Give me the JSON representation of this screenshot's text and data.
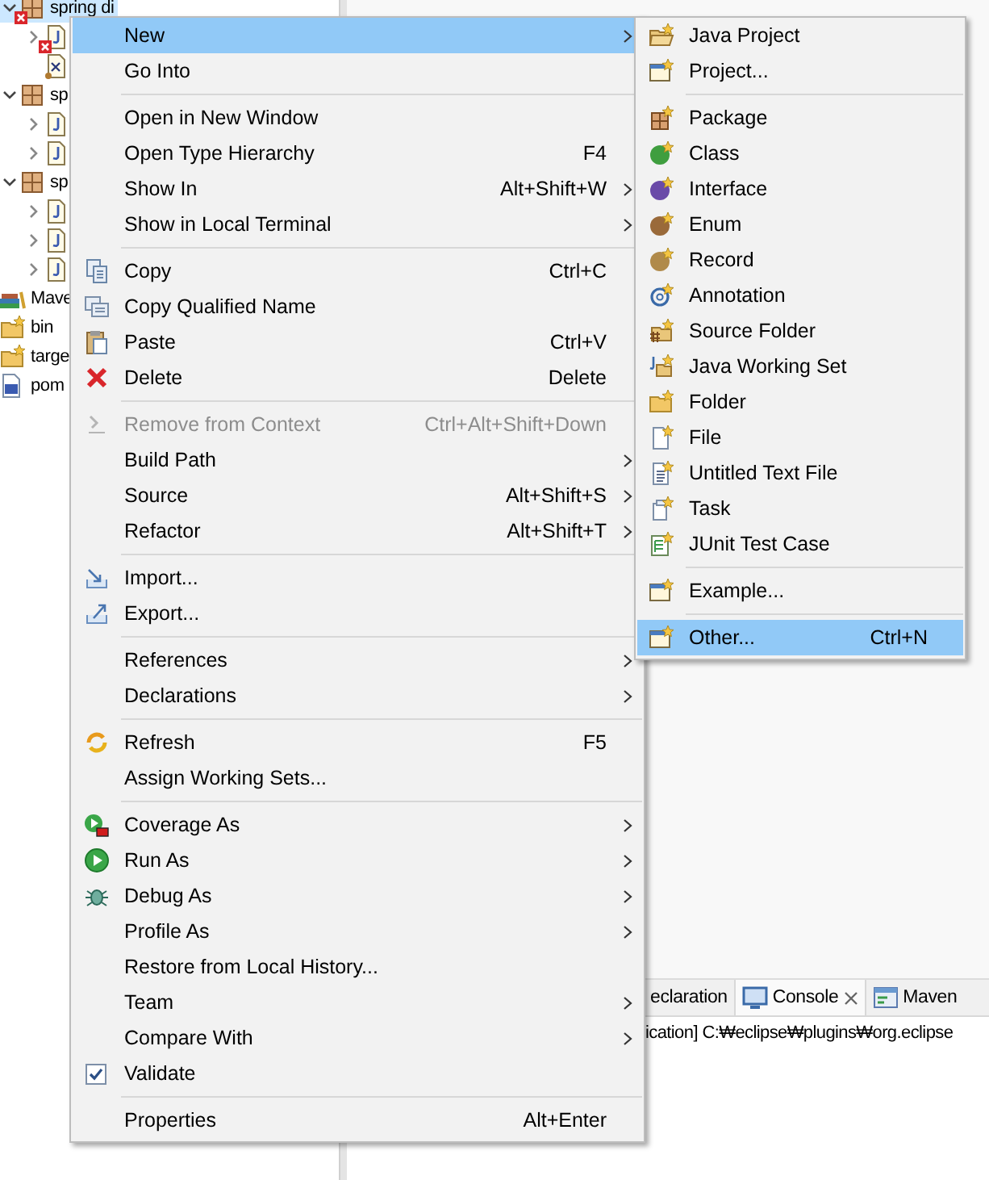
{
  "tree": [
    {
      "label": "spring di",
      "kind": "project",
      "error": true,
      "selected": true,
      "expanded": true,
      "children": [
        {
          "kind": "javafile",
          "error": true,
          "selected": false,
          "expanded": false
        },
        {
          "kind": "xmlfile",
          "error": false,
          "selected": false
        }
      ]
    },
    {
      "label": "sp",
      "kind": "project",
      "error": false,
      "selected": false,
      "expanded": true,
      "children": [
        {
          "kind": "javafile",
          "error": false,
          "selected": false,
          "expanded": false
        },
        {
          "kind": "javafile",
          "error": false,
          "selected": false,
          "expanded": false
        }
      ]
    },
    {
      "label": "sp",
      "kind": "project",
      "error": false,
      "selected": false,
      "expanded": true,
      "children": [
        {
          "kind": "javafile",
          "error": false,
          "selected": false,
          "expanded": false
        },
        {
          "kind": "javafile",
          "error": false,
          "selected": false,
          "expanded": false
        },
        {
          "kind": "javafile",
          "error": false,
          "selected": false,
          "expanded": false
        }
      ]
    }
  ],
  "tree_extra": [
    {
      "label": "Mave",
      "kind": "library"
    },
    {
      "label": "bin",
      "kind": "folder"
    },
    {
      "label": "targe",
      "kind": "folder"
    },
    {
      "label": "pom",
      "kind": "pom"
    }
  ],
  "context_menu": [
    {
      "kind": "plain",
      "label": "New",
      "submenu": true,
      "selected": true
    },
    {
      "kind": "plain",
      "label": "Go Into",
      "selected": false
    },
    {
      "kind": "separator"
    },
    {
      "kind": "plain",
      "label": "Open in New Window",
      "selected": false
    },
    {
      "kind": "plain",
      "label": "Open Type Hierarchy",
      "shortcut": "F4",
      "selected": false
    },
    {
      "kind": "plain",
      "label": "Show In",
      "shortcut": "Alt+Shift+W",
      "submenu": true,
      "selected": false
    },
    {
      "kind": "plain",
      "label": "Show in Local Terminal",
      "submenu": true,
      "selected": false
    },
    {
      "kind": "separator"
    },
    {
      "kind": "copy",
      "label": "Copy",
      "shortcut": "Ctrl+C",
      "selected": false
    },
    {
      "kind": "copyname",
      "label": "Copy Qualified Name",
      "selected": false
    },
    {
      "kind": "paste",
      "label": "Paste",
      "shortcut": "Ctrl+V",
      "selected": false
    },
    {
      "kind": "delete",
      "label": "Delete",
      "shortcut": "Delete",
      "selected": false
    },
    {
      "kind": "separator"
    },
    {
      "kind": "remove",
      "label": "Remove from Context",
      "shortcut": "Ctrl+Alt+Shift+Down",
      "disabled": true,
      "selected": false
    },
    {
      "kind": "plain",
      "label": "Build Path",
      "submenu": true,
      "selected": false
    },
    {
      "kind": "plain",
      "label": "Source",
      "shortcut": "Alt+Shift+S",
      "submenu": true,
      "selected": false
    },
    {
      "kind": "plain",
      "label": "Refactor",
      "shortcut": "Alt+Shift+T",
      "submenu": true,
      "selected": false
    },
    {
      "kind": "separator"
    },
    {
      "kind": "import",
      "label": "Import...",
      "selected": false
    },
    {
      "kind": "export",
      "label": "Export...",
      "selected": false
    },
    {
      "kind": "separator"
    },
    {
      "kind": "plain",
      "label": "References",
      "submenu": true,
      "selected": false
    },
    {
      "kind": "plain",
      "label": "Declarations",
      "submenu": true,
      "selected": false
    },
    {
      "kind": "separator"
    },
    {
      "kind": "refresh",
      "label": "Refresh",
      "shortcut": "F5",
      "selected": false
    },
    {
      "kind": "plain",
      "label": "Assign Working Sets...",
      "selected": false
    },
    {
      "kind": "separator"
    },
    {
      "kind": "coverage",
      "label": "Coverage As",
      "submenu": true,
      "selected": false
    },
    {
      "kind": "run",
      "label": "Run As",
      "submenu": true,
      "selected": false
    },
    {
      "kind": "debug",
      "label": "Debug As",
      "submenu": true,
      "selected": false
    },
    {
      "kind": "plain",
      "label": "Profile As",
      "submenu": true,
      "selected": false
    },
    {
      "kind": "plain",
      "label": "Restore from Local History...",
      "selected": false
    },
    {
      "kind": "plain",
      "label": "Team",
      "submenu": true,
      "selected": false
    },
    {
      "kind": "plain",
      "label": "Compare With",
      "submenu": true,
      "selected": false
    },
    {
      "kind": "check",
      "label": "Validate",
      "selected": false
    },
    {
      "kind": "separator"
    },
    {
      "kind": "plain",
      "label": "Properties",
      "shortcut": "Alt+Enter",
      "selected": false
    }
  ],
  "new_submenu": [
    {
      "kind": "javaproject",
      "label": "Java Project",
      "selected": false
    },
    {
      "kind": "window",
      "label": "Project...",
      "selected": false
    },
    {
      "kind": "separator"
    },
    {
      "kind": "package",
      "label": "Package",
      "selected": false
    },
    {
      "kind": "class",
      "label": "Class",
      "selected": false
    },
    {
      "kind": "interface",
      "label": "Interface",
      "selected": false
    },
    {
      "kind": "enum",
      "label": "Enum",
      "selected": false
    },
    {
      "kind": "record",
      "label": "Record",
      "selected": false
    },
    {
      "kind": "annotation",
      "label": "Annotation",
      "selected": false
    },
    {
      "kind": "sourcefolder",
      "label": "Source Folder",
      "selected": false
    },
    {
      "kind": "workingset",
      "label": "Java Working Set",
      "selected": false
    },
    {
      "kind": "folder",
      "label": "Folder",
      "selected": false
    },
    {
      "kind": "file",
      "label": "File",
      "selected": false
    },
    {
      "kind": "textfile",
      "label": "Untitled Text File",
      "selected": false
    },
    {
      "kind": "task",
      "label": "Task",
      "selected": false
    },
    {
      "kind": "junit",
      "label": "JUnit Test Case",
      "selected": false
    },
    {
      "kind": "separator"
    },
    {
      "kind": "window",
      "label": "Example...",
      "selected": false
    },
    {
      "kind": "separator"
    },
    {
      "kind": "window",
      "label": "Other...",
      "shortcut": "Ctrl+N",
      "selected": true
    }
  ],
  "bottom_panel": {
    "tabs": [
      {
        "label": "eclaration",
        "kind": "plain",
        "selected": false
      },
      {
        "label": "Console",
        "kind": "console",
        "closable": true,
        "selected": true
      },
      {
        "label": "Maven",
        "kind": "maven",
        "selected": false
      }
    ],
    "console_line": "ication] C:₩eclipse₩plugins₩org.eclipse"
  }
}
